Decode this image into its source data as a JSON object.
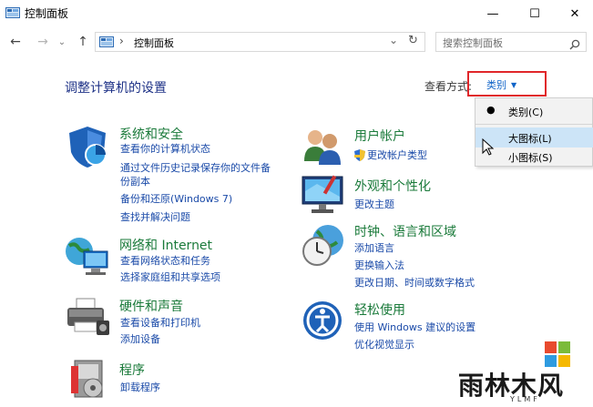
{
  "window": {
    "title": "控制面板",
    "minimize": "—",
    "maximize": "☐",
    "close": "✕"
  },
  "nav": {
    "back": "←",
    "forward": "→",
    "recent": "⌄",
    "up": "↑"
  },
  "address": {
    "separator": "›",
    "path": "控制面板",
    "dropdown": "⌄",
    "refresh": "↻"
  },
  "search": {
    "placeholder": "搜索控制面板"
  },
  "header": {
    "title": "调整计算机的设置",
    "view_by_label": "查看方式:",
    "view_by_value": "类别",
    "view_by_arrow": "▼"
  },
  "view_menu": {
    "items": [
      {
        "label": "类别(C)",
        "selected": true
      },
      {
        "label": "大图标(L)",
        "highlighted": true
      },
      {
        "label": "小图标(S)"
      }
    ]
  },
  "categories_left": [
    {
      "title": "系统和安全",
      "icon": "shield-icon",
      "links": [
        "查看你的计算机状态",
        "通过文件历史记录保存你的文件备",
        "份副本",
        "备份和还原(Windows 7)",
        "查找并解决问题"
      ]
    },
    {
      "title": "网络和 Internet",
      "icon": "network-icon",
      "links": [
        "查看网络状态和任务",
        "选择家庭组和共享选项"
      ]
    },
    {
      "title": "硬件和声音",
      "icon": "printer-icon",
      "links": [
        "查看设备和打印机",
        "添加设备"
      ]
    },
    {
      "title": "程序",
      "icon": "programs-icon",
      "links": [
        "卸载程序"
      ]
    }
  ],
  "categories_right": [
    {
      "title": "用户帐户",
      "icon": "users-icon",
      "links": [
        "更改帐户类型"
      ]
    },
    {
      "title": "外观和个性化",
      "icon": "monitor-icon",
      "links": [
        "更改主题"
      ]
    },
    {
      "title": "时钟、语言和区域",
      "icon": "clock-globe-icon",
      "links": [
        "添加语言",
        "更换输入法",
        "更改日期、时间或数字格式"
      ]
    },
    {
      "title": "轻松使用",
      "icon": "ease-of-access-icon",
      "links": [
        "使用 Windows 建议的设置",
        "优化视觉显示"
      ]
    }
  ],
  "watermark": {
    "text": "雨林木风",
    "sub": "YLMF"
  },
  "colors": {
    "link": "#1a4aa8",
    "category_title": "#1a7a3a",
    "highlight_box": "#e0262a"
  }
}
